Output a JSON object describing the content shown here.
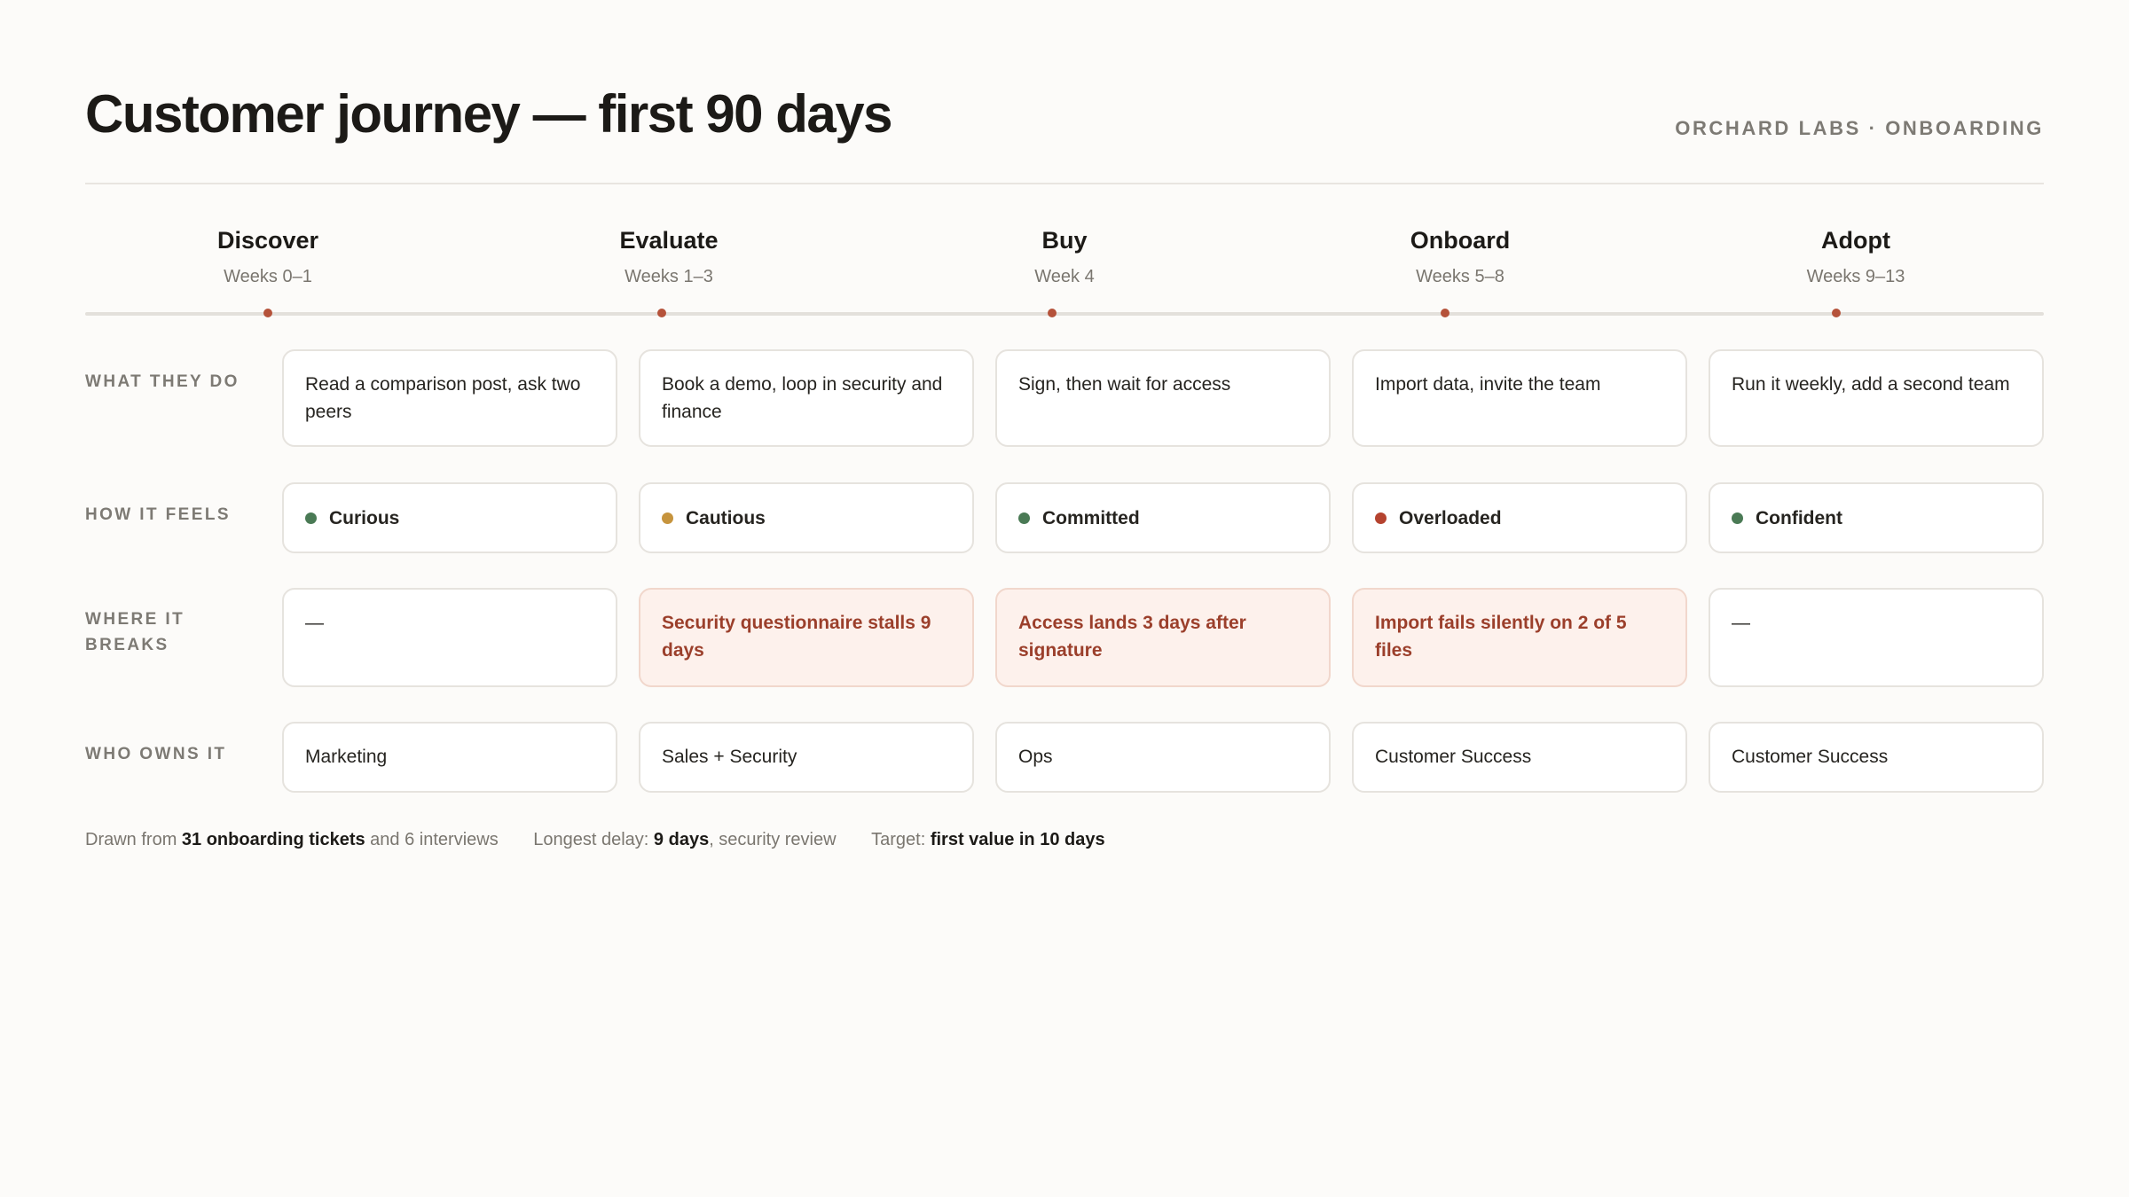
{
  "header": {
    "title": "Customer journey — first 90 days",
    "brand": "ORCHARD LABS · ONBOARDING"
  },
  "stages": [
    {
      "name": "Discover",
      "weeks": "Weeks 0–1"
    },
    {
      "name": "Evaluate",
      "weeks": "Weeks 1–3"
    },
    {
      "name": "Buy",
      "weeks": "Week 4"
    },
    {
      "name": "Onboard",
      "weeks": "Weeks 5–8"
    },
    {
      "name": "Adopt",
      "weeks": "Weeks 9–13"
    }
  ],
  "rows": {
    "what_they_do": {
      "label": "WHAT THEY DO",
      "cells": [
        "Read a comparison post, ask two peers",
        "Book a demo, loop in security and finance",
        "Sign, then wait for access",
        "Import data, invite the team",
        "Run it weekly, add a second team"
      ]
    },
    "how_it_feels": {
      "label": "HOW IT FEELS",
      "cells": [
        {
          "text": "Curious",
          "color": "#4a7a55"
        },
        {
          "text": "Cautious",
          "color": "#c6943d"
        },
        {
          "text": "Committed",
          "color": "#4a7a55"
        },
        {
          "text": "Overloaded",
          "color": "#b5432f"
        },
        {
          "text": "Confident",
          "color": "#4a7a55"
        }
      ]
    },
    "where_it_breaks": {
      "label": "WHERE IT BREAKS",
      "cells": [
        {
          "text": "—",
          "is_break": false
        },
        {
          "text": "Security questionnaire stalls 9 days",
          "is_break": true
        },
        {
          "text": "Access lands 3 days after signature",
          "is_break": true
        },
        {
          "text": "Import fails silently on 2 of 5 files",
          "is_break": true
        },
        {
          "text": "—",
          "is_break": false
        }
      ]
    },
    "who_owns_it": {
      "label": "WHO OWNS IT",
      "cells": [
        "Marketing",
        "Sales + Security",
        "Ops",
        "Customer Success",
        "Customer Success"
      ]
    }
  },
  "footer": {
    "source": {
      "prefix": "Drawn from ",
      "strong": "31 onboarding tickets",
      "suffix": " and 6 interviews"
    },
    "delay": {
      "prefix": "Longest delay: ",
      "strong": "9 days",
      "suffix": ", security review"
    },
    "target": {
      "prefix": "Target: ",
      "strong": "first value in 10 days",
      "suffix": ""
    }
  },
  "colors": {
    "accent": "#b5523a",
    "break_bg": "#fdf1ec",
    "break_text": "#9b3f2b"
  }
}
